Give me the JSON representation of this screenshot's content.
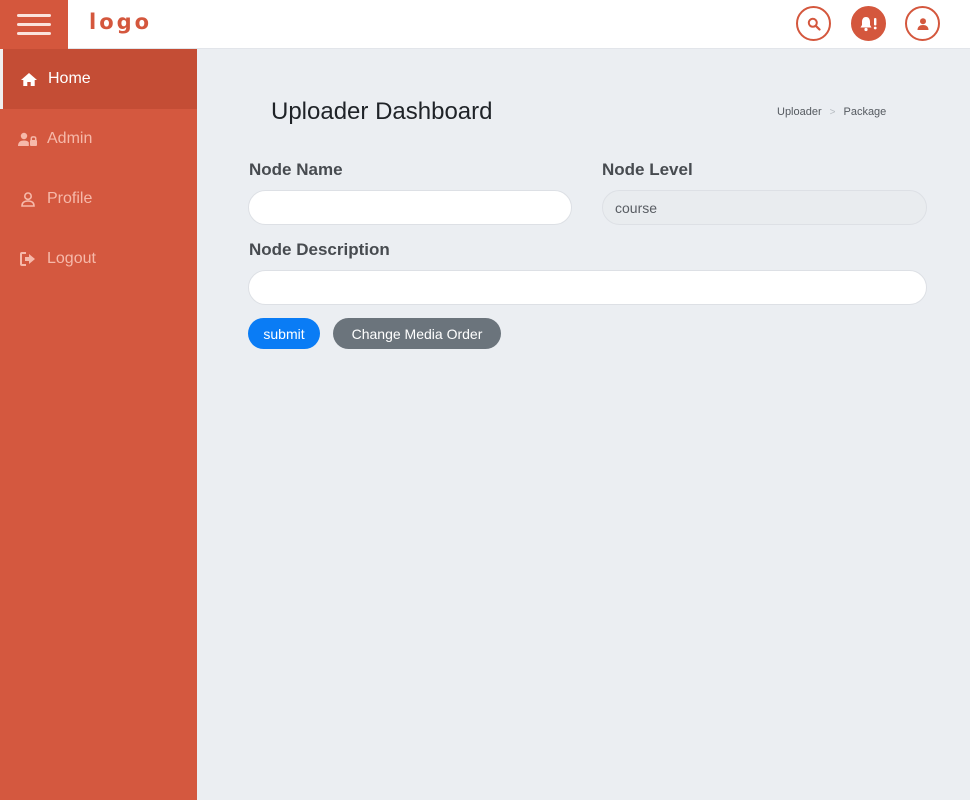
{
  "header": {
    "logo_text": "logo",
    "icons": [
      "menu-icon",
      "search-icon",
      "bell-alert-icon",
      "user-icon"
    ]
  },
  "sidebar": {
    "items": [
      {
        "label": "Home",
        "icon": "home-icon",
        "active": true
      },
      {
        "label": "Admin",
        "icon": "admin-icon",
        "active": false
      },
      {
        "label": "Profile",
        "icon": "user-icon",
        "active": false
      },
      {
        "label": "Logout",
        "icon": "logout-icon",
        "active": false
      }
    ]
  },
  "main": {
    "title": "Uploader Dashboard",
    "breadcrumb": {
      "first": "Uploader",
      "separator": ">",
      "second": "Package"
    },
    "form": {
      "node_name": {
        "label": "Node Name",
        "value": ""
      },
      "node_level": {
        "label": "Node Level",
        "value": "course"
      },
      "node_description": {
        "label": "Node Description",
        "value": ""
      },
      "submit_label": "submit",
      "change_order_label": "Change Media Order"
    }
  },
  "colors": {
    "brand": "#d4573d",
    "sidebar": "#d4583f",
    "sidebar_active": "#c44d35",
    "primary_button": "#0a7cf5",
    "secondary_button": "#6b747c",
    "background": "#ebeef2"
  }
}
